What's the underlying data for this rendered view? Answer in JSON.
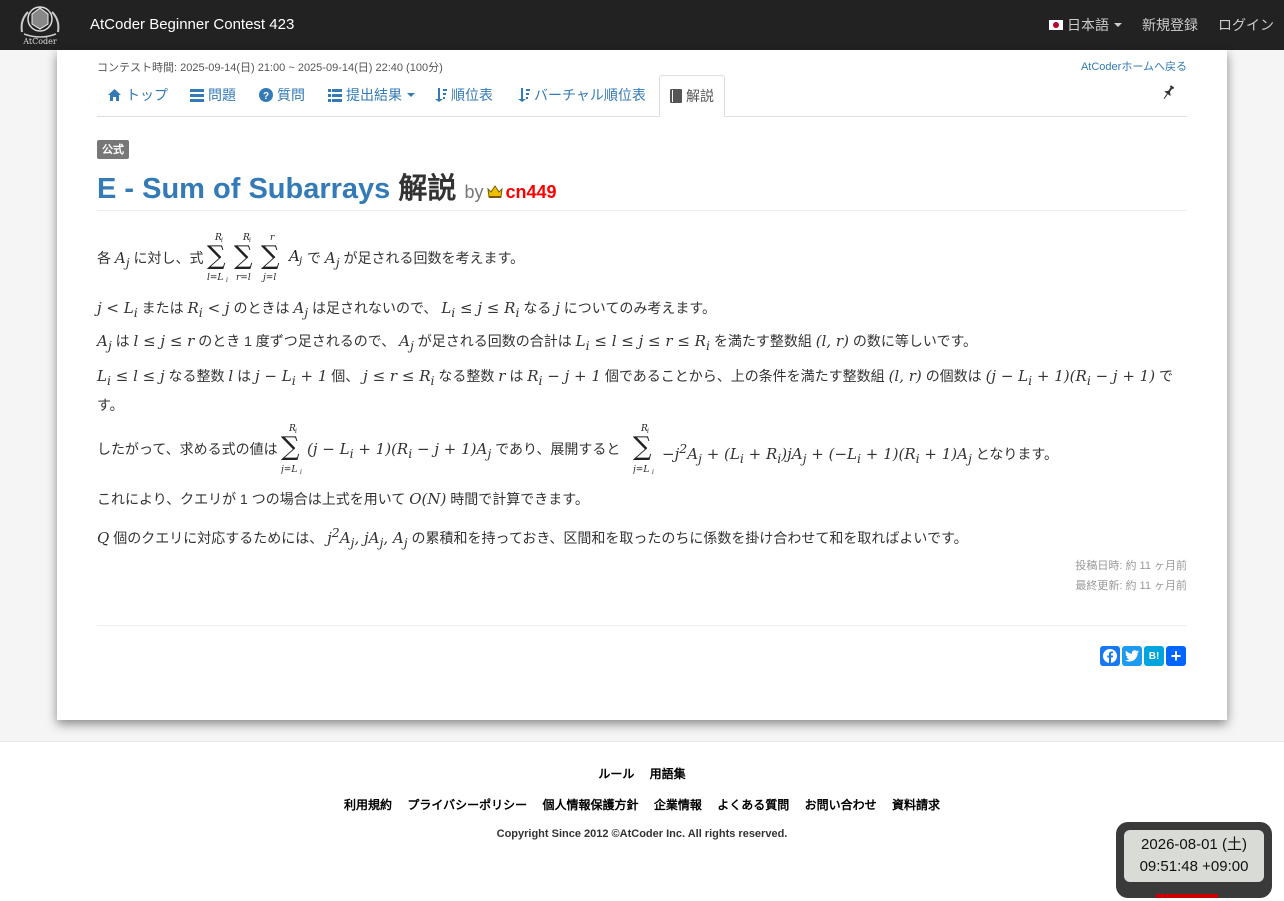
{
  "navbar": {
    "brand_text": "AtCoder",
    "contest_title": "AtCoder Beginner Contest 423",
    "language": "日本語",
    "signup": "新規登録",
    "login": "ログイン"
  },
  "contest": {
    "time": "コンテスト時間: 2025-09-14(日) 21:00 ~ 2025-09-14(日) 22:40 (100分)",
    "back_link": "AtCoderホームへ戻る"
  },
  "tabs": [
    {
      "label": "トップ",
      "icon": "home-icon"
    },
    {
      "label": "問題",
      "icon": "list-icon"
    },
    {
      "label": "質問",
      "icon": "question-icon"
    },
    {
      "label": "提出結果",
      "icon": "list-icon"
    },
    {
      "label": "順位表",
      "icon": "sort-icon"
    },
    {
      "label": "バーチャル順位表",
      "icon": "sort-icon"
    },
    {
      "label": "解説",
      "icon": "book-icon",
      "active": true
    }
  ],
  "editorial": {
    "badge": "公式",
    "problem_title": "E - Sum of Subarrays",
    "title_suffix": "解説",
    "by": "by",
    "author": "cn449",
    "author_color": "#ff0000",
    "posted": "投稿日時: 約 11 ヶ月前",
    "updated": "最終更新: 約 11 ヶ月前",
    "p1_a": "各",
    "p1_b": "に対し、式",
    "p1_c": "で",
    "p1_d": "が足される回数を考えます。",
    "p2_a": "または",
    "p2_b": "のときは",
    "p2_c": "は足されないので、",
    "p2_d": "なる",
    "p2_e": "についてのみ考えます。",
    "p3_a": "は",
    "p3_b": "のとき 1 度ずつ足されるので、",
    "p3_c": "が足される回数の合計は",
    "p3_d": "を満たす整数組",
    "p3_e": "の数に等しいです。",
    "p4_a": "なる整数",
    "p4_b": "は",
    "p4_c": "個、",
    "p4_d": "なる整数",
    "p4_e": "は",
    "p4_f": "個であることから、上の条件を満たす整数組",
    "p4_g": "の個数は",
    "p4_h": "で",
    "p4_i": "す。",
    "p5_a": "したがって、求める式の値は",
    "p5_b": "であり、展開すると",
    "p5_c": "となります。",
    "p6_a": "これにより、クエリが 1 つの場合は上式を用いて",
    "p6_b": "時間で計算できます。",
    "p7_a": "個のクエリに対応するためには、",
    "p7_b": "の累積和を持っておき、区間和を取ったのちに係数を掛け合わせて和を取ればよいです。"
  },
  "footer": {
    "row1": [
      "ルール",
      "用語集"
    ],
    "row2": [
      "利用規約",
      "プライバシーポリシー",
      "個人情報保護方針",
      "企業情報",
      "よくある質問",
      "お問い合わせ",
      "資料請求"
    ],
    "copyright": "Copyright Since 2012 ©AtCoder Inc. All rights reserved."
  },
  "clock": {
    "date": "2026-08-01 (土)",
    "time": "09:51:48 +09:00"
  },
  "colors": {
    "navbar_bg": "#222222",
    "link": "#337ab7",
    "author_red": "#ff0000"
  }
}
